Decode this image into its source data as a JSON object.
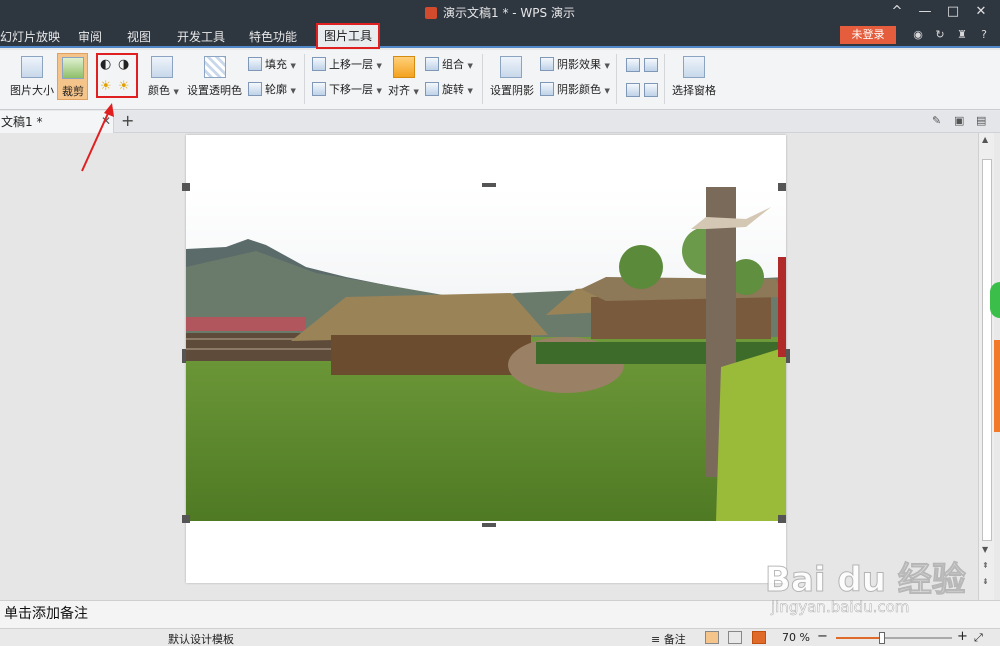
{
  "window": {
    "title": "演示文稿1 * - WPS 演示",
    "controls": [
      "^",
      "—",
      "□",
      "✕"
    ]
  },
  "menu": {
    "tabs": [
      "幻灯片放映",
      "审阅",
      "视图",
      "开发工具",
      "特色功能",
      "图片工具"
    ],
    "active_tab": "图片工具",
    "login": "未登录",
    "help": "?"
  },
  "ribbon": {
    "picture_size": "图片大小",
    "crop": "裁剪",
    "color": "颜色",
    "set_transparent": "设置透明色",
    "fill": "填充",
    "outline": "轮廓",
    "bring_forward": "上移一层",
    "send_backward": "下移一层",
    "align": "对齐",
    "group": "组合",
    "rotate": "旋转",
    "shadow_set": "设置阴影",
    "shadow_effect": "阴影效果",
    "shadow_color": "阴影颜色",
    "selection_pane": "选择窗格"
  },
  "tabs": {
    "doc_name": "文稿1 *",
    "add": "+"
  },
  "notes": {
    "placeholder": "单击添加备注"
  },
  "status": {
    "template": "默认设计模板",
    "notes_btn": "备注",
    "zoom": "70 %",
    "zoom_level": 0.4
  },
  "watermark": {
    "brand": "Bai du 经验",
    "url": "jingyan.baidu.com"
  },
  "colors": {
    "title_bg": "#2e3640",
    "accent_red": "#e02020",
    "login_bg": "#e55d3c",
    "zoom_fill": "#e06a2a"
  }
}
